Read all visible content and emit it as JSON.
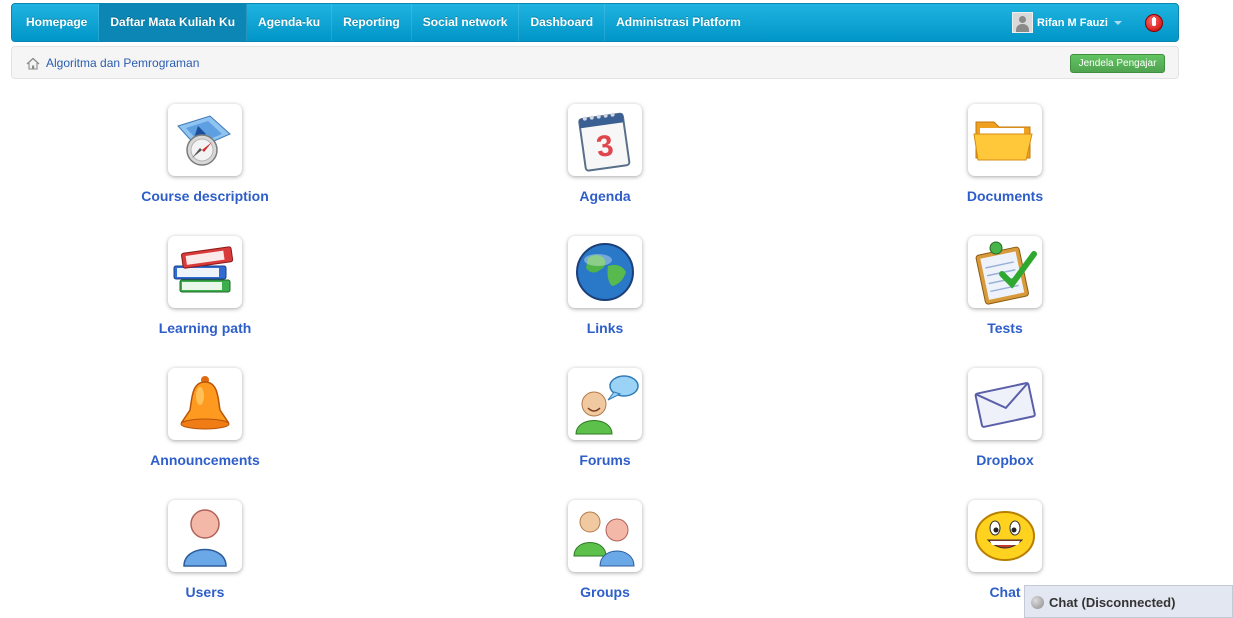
{
  "navbar": {
    "items": [
      {
        "label": "Homepage",
        "active": false
      },
      {
        "label": "Daftar Mata Kuliah Ku",
        "active": true
      },
      {
        "label": "Agenda-ku",
        "active": false
      },
      {
        "label": "Reporting",
        "active": false
      },
      {
        "label": "Social network",
        "active": false
      },
      {
        "label": "Dashboard",
        "active": false
      },
      {
        "label": "Administrasi Platform",
        "active": false
      }
    ],
    "user_name": "Rifan M Fauzi"
  },
  "breadcrumb": {
    "course": "Algoritma dan Pemrograman",
    "teacher_button": "Jendela Pengajar"
  },
  "tools": [
    {
      "label": "Course description",
      "icon": "compass-map-icon"
    },
    {
      "label": "Agenda",
      "icon": "calendar-icon"
    },
    {
      "label": "Documents",
      "icon": "folder-icon"
    },
    {
      "label": "Learning path",
      "icon": "books-icon"
    },
    {
      "label": "Links",
      "icon": "globe-icon"
    },
    {
      "label": "Tests",
      "icon": "checklist-icon"
    },
    {
      "label": "Announcements",
      "icon": "bell-icon"
    },
    {
      "label": "Forums",
      "icon": "speech-person-icon"
    },
    {
      "label": "Dropbox",
      "icon": "envelope-icon"
    },
    {
      "label": "Users",
      "icon": "user-icon"
    },
    {
      "label": "Groups",
      "icon": "group-icon"
    },
    {
      "label": "Chat",
      "icon": "smiley-icon"
    }
  ],
  "chat": {
    "status": "Chat (Disconnected)"
  },
  "colors": {
    "navbar": "#0aa6d8",
    "link": "#2d5ec9",
    "button_green": "#5cb85c"
  }
}
